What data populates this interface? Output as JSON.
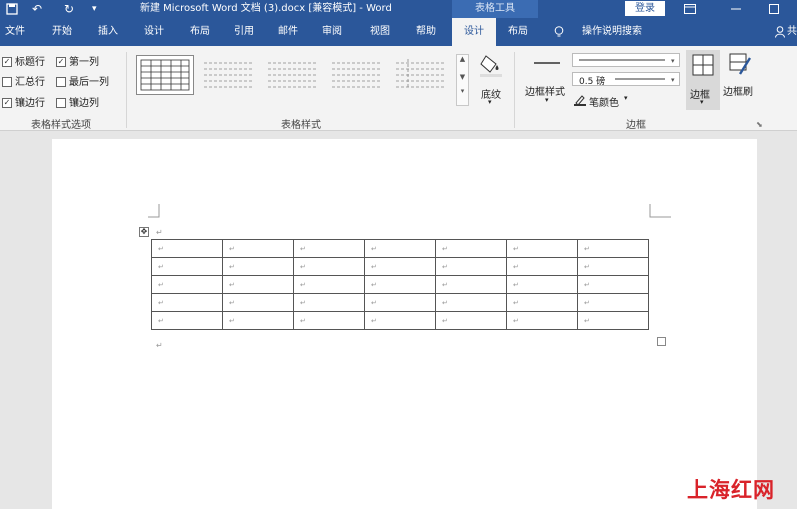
{
  "title_bar": {
    "document_title": "新建 Microsoft Word 文档 (3).docx [兼容模式]  -  Word",
    "context_tool_label": "表格工具",
    "login_label": "登录",
    "undo_icon": "↶",
    "redo_icon": "↻",
    "customize_icon": "▾"
  },
  "tabs": [
    "文件",
    "开始",
    "插入",
    "设计",
    "布局",
    "引用",
    "邮件",
    "审阅",
    "视图",
    "帮助",
    "设计",
    "布局"
  ],
  "active_tab_index": 10,
  "tell_me": "操作说明搜索",
  "share_label": "共",
  "table_style_options": {
    "items": [
      {
        "label": "标题行",
        "checked": true
      },
      {
        "label": "第一列",
        "checked": true
      },
      {
        "label": "汇总行",
        "checked": false
      },
      {
        "label": "最后一列",
        "checked": false
      },
      {
        "label": "镶边行",
        "checked": true
      },
      {
        "label": "镶边列",
        "checked": false
      }
    ],
    "group_label": "表格样式选项"
  },
  "table_styles": {
    "group_label": "表格样式",
    "shading_label": "底纹"
  },
  "borders": {
    "border_styles_label": "边框样式",
    "weight_value": "0.5 磅",
    "pen_color_label": "笔颜色",
    "borders_label": "边框",
    "border_painter_label": "边框刷",
    "group_label": "边框"
  },
  "document": {
    "paragraph_mark": "↵",
    "rows": 5,
    "cols": 7
  },
  "watermark": "上海红网",
  "colors": {
    "accent": "#2b579a",
    "ribbon_bg": "#f3f3f3",
    "watermark": "#d9232a"
  }
}
